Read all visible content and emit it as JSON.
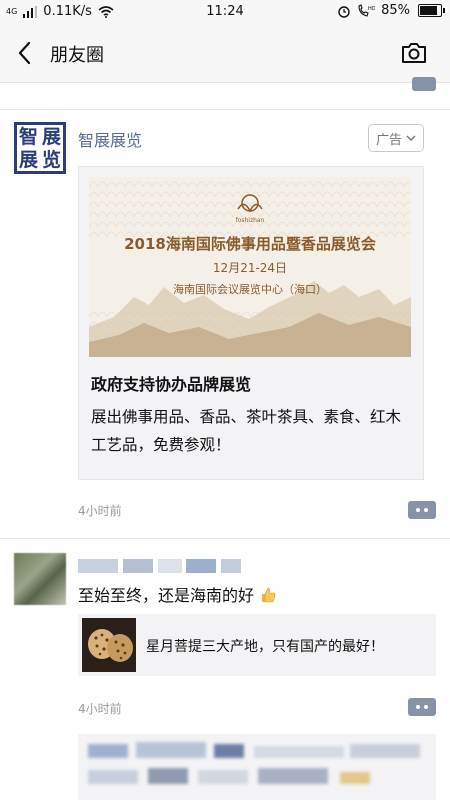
{
  "status_bar": {
    "network_type": "4G",
    "speed": "0.11K/s",
    "time": "11:24",
    "battery_percent": "85%",
    "battery_level": 0.85
  },
  "nav": {
    "title": "朋友圈"
  },
  "ad_post": {
    "author": "智展展览",
    "logo_chars": [
      "智",
      "展",
      "展",
      "览"
    ],
    "ad_label": "广告",
    "banner": {
      "logo_text": "foshizhan",
      "title": "2018海南国际佛事用品暨香品展览会",
      "date": "12月21-24日",
      "venue": "海南国际会议展览中心（海口）"
    },
    "headline": "政府支持协办品牌展览",
    "description": "展出佛事用品、香品、茶叶茶具、素食、红木工艺品，免费参观！",
    "time": "4小时前"
  },
  "second_post": {
    "text": "至始至终，还是海南的好",
    "shared_link_title": "星月菩提三大产地，只有国产的最好！",
    "time": "4小时前"
  },
  "colors": {
    "link_blue": "#576b95",
    "comment_button": "#8892a6",
    "card_bg": "#f3f3f5"
  }
}
